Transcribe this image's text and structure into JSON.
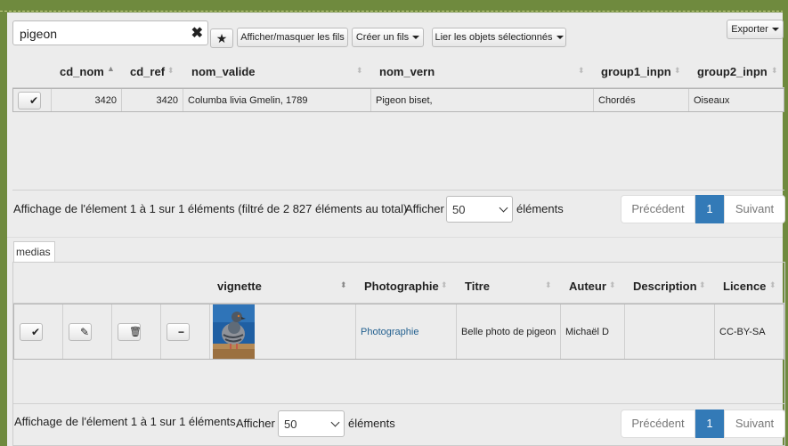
{
  "toolbar": {
    "search_value": "pigeon",
    "clear_glyph": "✖",
    "favorite_glyph": "★",
    "toggle_children_label": "Afficher/masquer les fils",
    "create_child_label": "Créer un fils",
    "link_selected_label": "Lier les objets sélectionnés",
    "export_label": "Exporter"
  },
  "taxa_table": {
    "columns": [
      "cd_nom",
      "cd_ref",
      "nom_valide",
      "nom_vern",
      "group1_inpn",
      "group2_inpn"
    ],
    "rows": [
      {
        "check": "✔",
        "cd_nom": "3420",
        "cd_ref": "3420",
        "nom_valide": "Columba livia Gmelin, 1789",
        "nom_vern": "Pigeon biset,",
        "group1_inpn": "Chordés",
        "group2_inpn": "Oiseaux"
      }
    ],
    "info_text": "Affichage de l'élement 1 à 1 sur 1 éléments (filtré de 2 827 éléments au total)",
    "show_label": "Afficher",
    "page_size": "50",
    "elements_label": "éléments",
    "prev_label": "Précédent",
    "page": "1",
    "next_label": "Suivant"
  },
  "medias": {
    "tab_label": "medias",
    "columns": [
      "vignette",
      "Photographie",
      "Titre",
      "Auteur",
      "Description",
      "Licence"
    ],
    "rows": [
      {
        "check": "✔",
        "edit": "✎",
        "delete": "🗑",
        "remove": "−",
        "photographie": "Photographie",
        "titre": "Belle photo de pigeon",
        "auteur": "Michaël D",
        "description": "",
        "licence": "CC-BY-SA"
      }
    ],
    "info_text": "Affichage de l'élement 1 à 1 sur 1 éléments",
    "show_label": "Afficher",
    "page_size": "50",
    "elements_label": "éléments",
    "prev_label": "Précédent",
    "page": "1",
    "next_label": "Suivant"
  }
}
